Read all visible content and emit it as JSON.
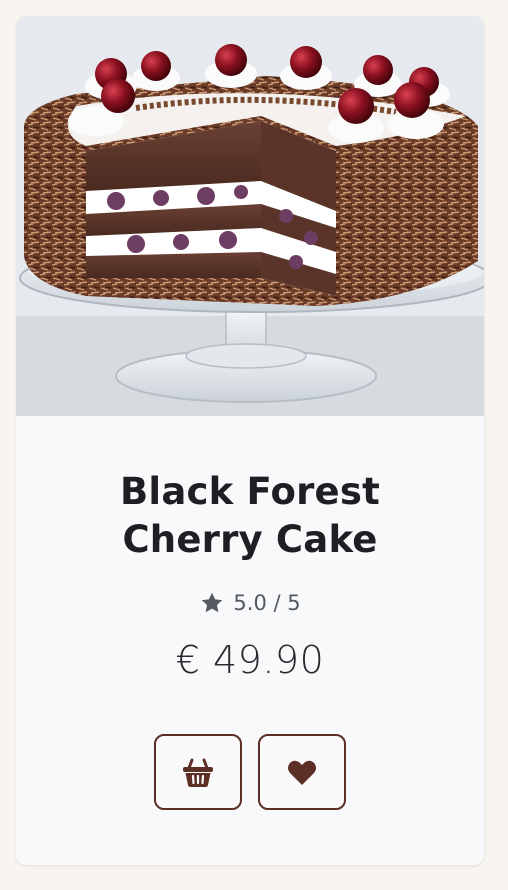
{
  "product": {
    "name_line1": "Black Forest",
    "name_line2": "Cherry Cake",
    "rating_text": "5.0 / 5",
    "rating_value": 5.0,
    "rating_max": 5,
    "price": "€ 49.90"
  },
  "icons": {
    "rating": "star-icon",
    "cart": "basket-icon",
    "favorite": "heart-icon"
  },
  "colors": {
    "accent": "#5b2f26",
    "text": "#1f1f23",
    "muted": "#555a60",
    "card_bg": "#f8f9fb"
  }
}
